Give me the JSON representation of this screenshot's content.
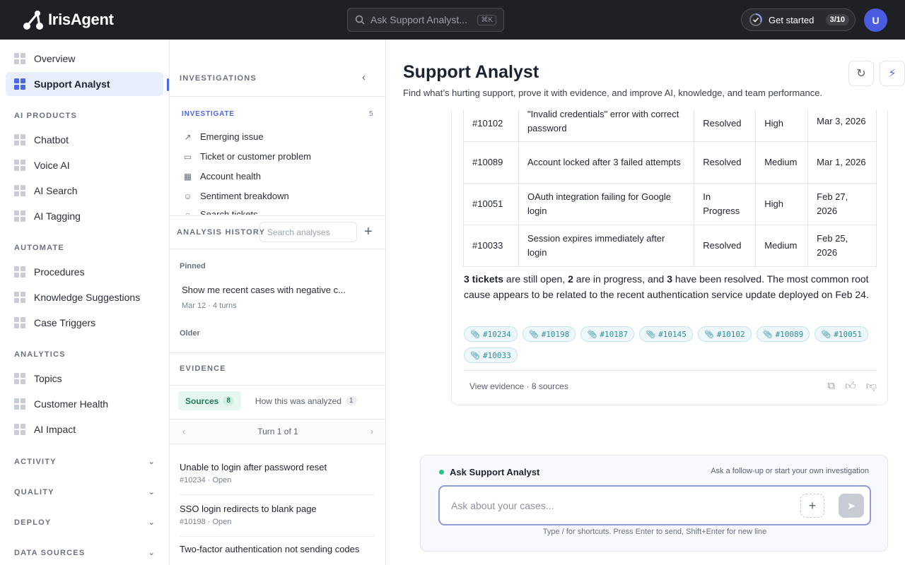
{
  "topbar": {
    "brand": "IrisAgent",
    "search_placeholder": "Ask Support Analyst...",
    "search_kbd": "⌘K",
    "get_started_label": "Get started",
    "get_started_count": "3/10",
    "avatar_initial": "U"
  },
  "sidebar": {
    "top_items": [
      "Overview",
      "Support Analyst"
    ],
    "sections": [
      {
        "label": "AI PRODUCTS",
        "items": [
          "Chatbot",
          "Voice AI",
          "AI Search",
          "AI Tagging"
        ]
      },
      {
        "label": "AUTOMATE",
        "items": [
          "Procedures",
          "Knowledge Suggestions",
          "Case Triggers"
        ]
      },
      {
        "label": "ANALYTICS",
        "items": [
          "Topics",
          "Customer Health",
          "AI Impact"
        ]
      }
    ],
    "collapsed": [
      "ACTIVITY",
      "QUALITY",
      "DEPLOY",
      "DATA SOURCES"
    ]
  },
  "investigations": {
    "header": "INVESTIGATIONS",
    "investigate_label": "INVESTIGATE",
    "investigate_count": "5",
    "items": [
      {
        "label": "Emerging issue",
        "icon": "trend-icon"
      },
      {
        "label": "Ticket or customer problem",
        "icon": "ticket-icon"
      },
      {
        "label": "Account health",
        "icon": "building-icon"
      },
      {
        "label": "Sentiment breakdown",
        "icon": "smile-icon"
      },
      {
        "label": "Search tickets",
        "icon": "search-icon"
      }
    ]
  },
  "history": {
    "header": "ANALYSIS HISTORY",
    "search_placeholder": "Search analyses",
    "pinned_label": "Pinned",
    "pinned_title": "Show me recent cases with negative c...",
    "pinned_meta": "Mar 12 · 4 turns",
    "older_label": "Older"
  },
  "evidence": {
    "header": "EVIDENCE",
    "tab_sources": "Sources",
    "tab_sources_count": "8",
    "tab_analyzed": "How this was analyzed",
    "tab_analyzed_count": "1",
    "turn_label": "Turn 1 of 1",
    "sources": [
      {
        "title": "Unable to login after password reset",
        "meta": "#10234 · Open"
      },
      {
        "title": "SSO login redirects to blank page",
        "meta": "#10198 · Open"
      },
      {
        "title": "Two-factor authentication not sending codes",
        "meta": ""
      }
    ]
  },
  "main": {
    "title": "Support Analyst",
    "subtitle": "Find what’s hurting support, prove it with evidence, and improve AI, knowledge, and team performance.",
    "table_rows": [
      {
        "id": "#10102",
        "issue": "\"Invalid credentials\" error with correct password",
        "status": "Resolved",
        "priority": "High",
        "date": "Mar 3, 2026"
      },
      {
        "id": "#10089",
        "issue": "Account locked after 3 failed attempts",
        "status": "Resolved",
        "priority": "Medium",
        "date": "Mar 1, 2026"
      },
      {
        "id": "#10051",
        "issue": "OAuth integration failing for Google login",
        "status": "In Progress",
        "priority": "High",
        "date": "Feb 27, 2026"
      },
      {
        "id": "#10033",
        "issue": "Session expires immediately after login",
        "status": "Resolved",
        "priority": "Medium",
        "date": "Feb 25, 2026"
      }
    ],
    "summary": {
      "open_count": "3 tickets",
      "open_suffix": " are still open, ",
      "progress_count": "2",
      "progress_suffix": " are in progress, and ",
      "resolved_count": "3",
      "resolved_suffix": " have been resolved. The most common root cause appears to be related to the recent authentication service update deployed on Feb 24."
    },
    "chips": [
      "#10234",
      "#10198",
      "#10187",
      "#10145",
      "#10102",
      "#10089",
      "#10051",
      "#10033"
    ],
    "view_evidence": "View evidence · 8 sources"
  },
  "ask": {
    "title": "Ask Support Analyst",
    "hint": "Ask a follow-up or start your own investigation",
    "placeholder": "Ask about your cases...",
    "footer": "Type / for shortcuts. Press Enter to send, Shift+Enter for new line"
  },
  "colors": {
    "accent": "#4e67e5",
    "topbar": "#1f2024",
    "chip": "#2a8ba0",
    "status_dot": "#27c48a"
  }
}
